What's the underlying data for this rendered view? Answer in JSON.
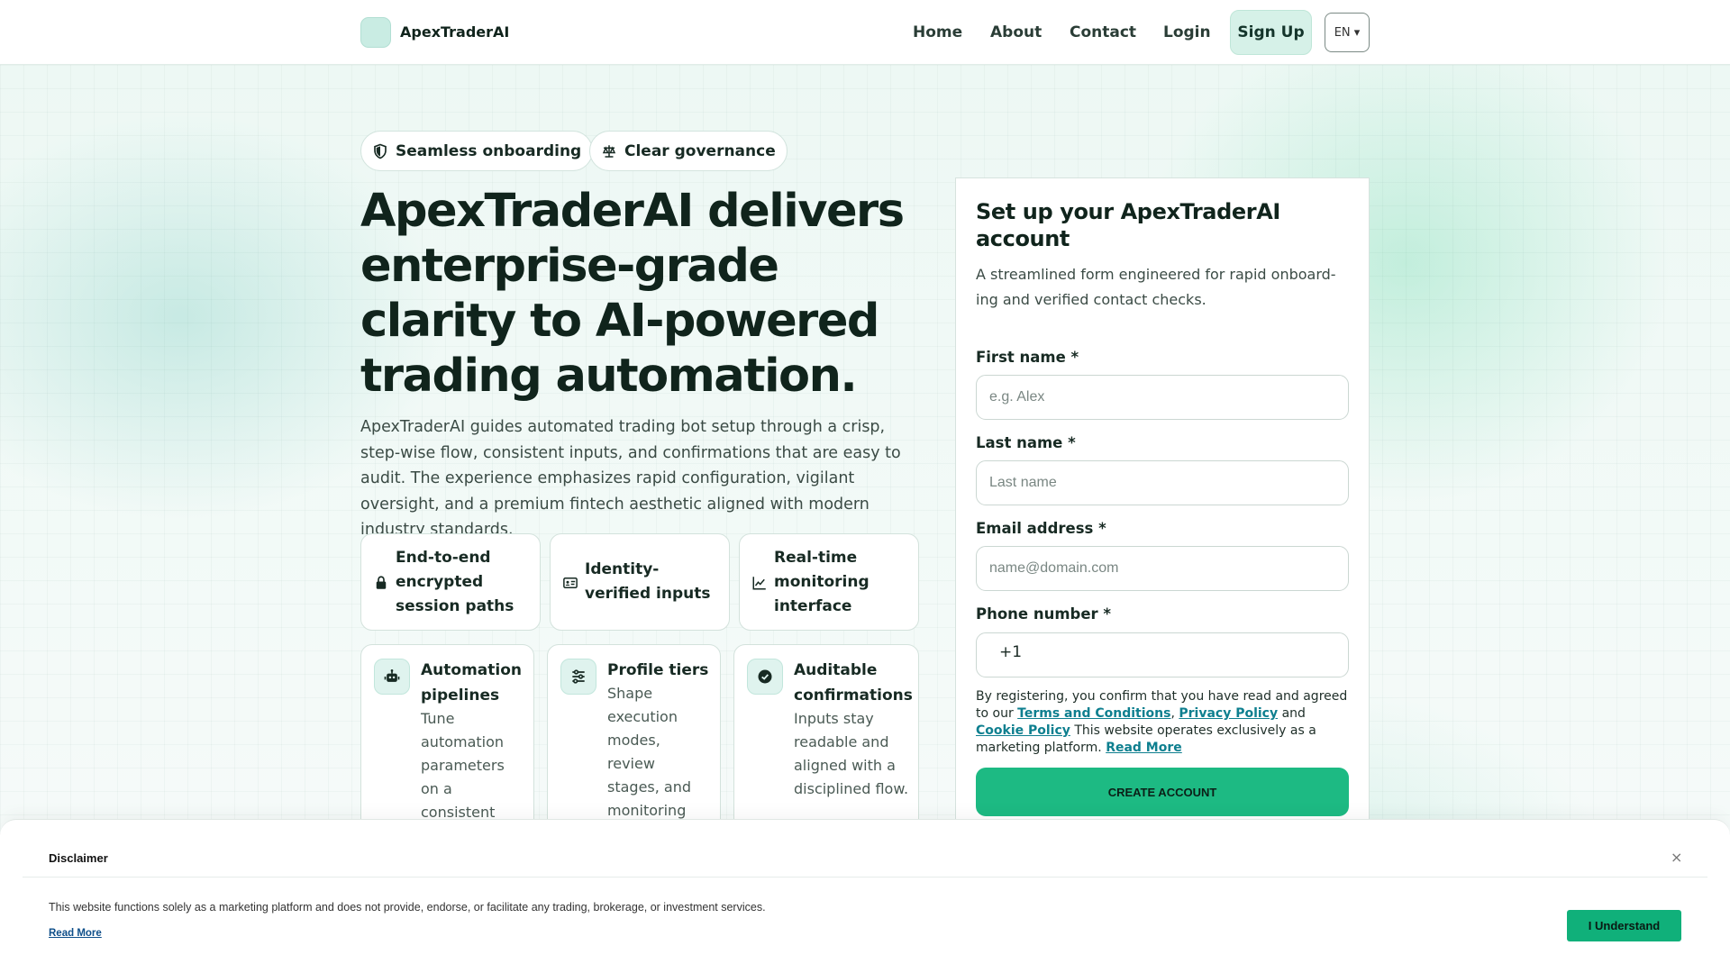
{
  "brand": {
    "name": "ApexTraderAI"
  },
  "nav": {
    "home": "Home",
    "about": "About",
    "contact": "Contact",
    "login": "Login",
    "signup": "Sign Up",
    "language": "EN ▾"
  },
  "hero": {
    "pills": [
      "Seamless onboarding",
      "Clear governance"
    ],
    "headline": "ApexTraderAI delivers enterprise-grade clarity to AI-powered trading automation.",
    "lead": "ApexTraderAI guides automated trading bot setup through a crisp, step-wise flow, consistent inputs, and confirmations that are easy to audit. The experience emphasizes rapid configuration, vigilant oversight, and a premium fintech aesthetic aligned with modern industry standards.",
    "features": [
      {
        "label": "End-to-end encrypted session paths",
        "icon": "lock-icon"
      },
      {
        "label": "Identity-verified inputs",
        "icon": "id-card-icon"
      },
      {
        "label": "Real-time monitoring interface",
        "icon": "chart-line-icon"
      }
    ],
    "cards": [
      {
        "title": "Automation pipelines",
        "desc": "Tune automation parameters on a consistent",
        "icon": "robot-icon"
      },
      {
        "title": "Profile tiers",
        "desc": "Shape execution modes, review stages, and monitoring density.",
        "icon": "sliders-icon"
      },
      {
        "title": "Auditable confirmations",
        "desc": "Inputs stay readable and aligned with a disciplined flow.",
        "icon": "check-circle-icon"
      }
    ]
  },
  "form": {
    "title": "Set up your ApexTraderAI account",
    "subtitle": "A streamlined form engineered for rapid onboard-ing and verified contact checks.",
    "first_name_label": "First name *",
    "first_name_placeholder": "e.g. Alex",
    "last_name_label": "Last name *",
    "last_name_placeholder": "Last name",
    "email_label": "Email address *",
    "email_placeholder": "name@domain.com",
    "phone_label": "Phone number *",
    "phone_prefix": "+1",
    "legal_intro": "By registering, you confirm that you have read and agreed to our",
    "terms_link": "Terms and Conditions",
    "privacy_link": "Privacy Policy",
    "and": "and",
    "cookie_link": "Cookie Policy",
    "legal_tail": "This website operates exclusively as a marketing platform.",
    "read_more": "Read More",
    "submit": "CREATE ACCOUNT"
  },
  "disclaimer": {
    "title": "Disclaimer",
    "close": "×",
    "text": "This website functions solely as a marketing platform and does not provide, endorse, or facilitate any trading, brokerage, or investment services.",
    "read_more": "Read More",
    "accept": "I Understand"
  },
  "colors": {
    "accent": "#1dba83",
    "link": "#0e7f8f",
    "mint": "#d6f1e8"
  }
}
